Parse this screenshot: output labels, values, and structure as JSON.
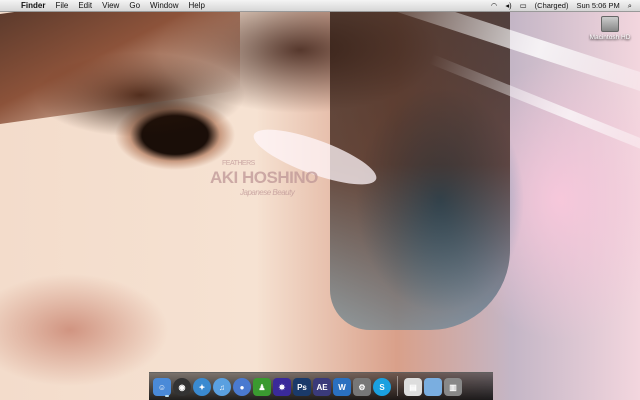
{
  "menubar": {
    "items": [
      "Finder",
      "File",
      "Edit",
      "View",
      "Go",
      "Window",
      "Help"
    ],
    "status": {
      "battery": "(Charged)",
      "clock": "Sun 5:06 PM"
    }
  },
  "desktop": {
    "drive_label": "Macintosh HD",
    "watermark": {
      "top": "Feathers",
      "name": "Aki Hoshino",
      "sub": "Japanese Beauty"
    }
  },
  "dock": {
    "apps": [
      {
        "name": "Finder",
        "glyph": "☺",
        "color": "#4a8ad8"
      },
      {
        "name": "Dashboard",
        "glyph": "◉",
        "color": "#333"
      },
      {
        "name": "Safari",
        "glyph": "✦",
        "color": "#3a8ad0"
      },
      {
        "name": "iTunes",
        "glyph": "♫",
        "color": "#5aa0e0"
      },
      {
        "name": "iChat",
        "glyph": "●",
        "color": "#4a7ad0"
      },
      {
        "name": "Adium",
        "glyph": "♟",
        "color": "#3a9a30"
      },
      {
        "name": "Motion",
        "glyph": "✸",
        "color": "#3a2a9a"
      },
      {
        "name": "Photoshop",
        "glyph": "Ps",
        "color": "#1a3a6a"
      },
      {
        "name": "After Effects",
        "glyph": "AE",
        "color": "#3a3a7a"
      },
      {
        "name": "W App",
        "glyph": "W",
        "color": "#2a70c0"
      },
      {
        "name": "System Preferences",
        "glyph": "⚙",
        "color": "#777"
      },
      {
        "name": "Skype",
        "glyph": "S",
        "color": "#1aa0e0"
      }
    ],
    "docs": [
      {
        "name": "Preview",
        "glyph": "▤",
        "color": "#ddd"
      },
      {
        "name": "Downloads",
        "glyph": "",
        "color": "#7aaee0"
      },
      {
        "name": "Trash",
        "glyph": "▥",
        "color": "#888"
      }
    ]
  }
}
